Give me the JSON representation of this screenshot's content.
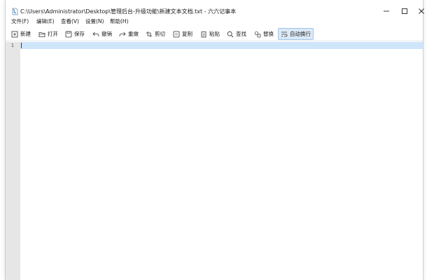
{
  "window": {
    "title": "C:\\Users\\Administrator\\Desktop\\管理后台-升级功能\\新建文本文档.txt - 六六记事本"
  },
  "menu": [
    {
      "label": "文件(F)"
    },
    {
      "label": "编辑(E)"
    },
    {
      "label": "查看(V)"
    },
    {
      "label": "设置(N)"
    },
    {
      "label": "帮助(H)"
    }
  ],
  "toolbar": [
    {
      "label": "新建",
      "icon": "new-file-icon"
    },
    {
      "label": "打开",
      "icon": "folder-open-icon"
    },
    {
      "label": "保存",
      "icon": "save-icon"
    },
    {
      "label": "撤销",
      "icon": "undo-icon"
    },
    {
      "label": "重做",
      "icon": "redo-icon"
    },
    {
      "label": "剪切",
      "icon": "cut-icon"
    },
    {
      "label": "复制",
      "icon": "copy-icon"
    },
    {
      "label": "粘贴",
      "icon": "paste-icon"
    },
    {
      "label": "查找",
      "icon": "search-icon"
    },
    {
      "label": "替换",
      "icon": "replace-icon"
    },
    {
      "label": "自动换行",
      "icon": "word-wrap-icon",
      "active": true
    }
  ],
  "editor": {
    "line_numbers": [
      "1"
    ],
    "current_line_color": "#cfe5fa",
    "caret_color": "#b00040"
  },
  "colors": {
    "active_button_bg": "#dce9f6",
    "gutter_bg": "#e6e6e6"
  }
}
